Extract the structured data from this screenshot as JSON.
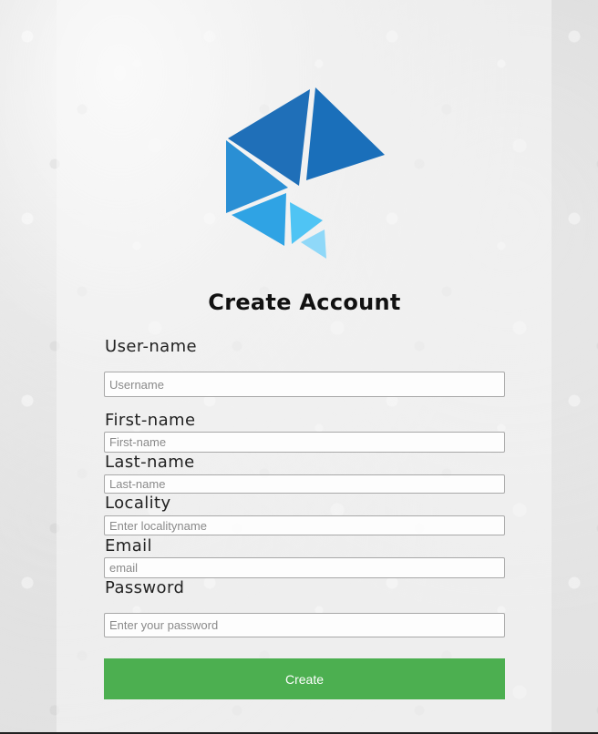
{
  "form": {
    "title": "Create Account",
    "fields": [
      {
        "label": "User-name",
        "placeholder": "Username",
        "value": ""
      },
      {
        "label": "First-name",
        "placeholder": "First-name",
        "value": ""
      },
      {
        "label": "Last-name",
        "placeholder": "Last-name",
        "value": ""
      },
      {
        "label": "Locality",
        "placeholder": "Enter localityname",
        "value": ""
      },
      {
        "label": "Email",
        "placeholder": "email",
        "value": ""
      },
      {
        "label": "Password",
        "placeholder": "Enter your password",
        "value": ""
      }
    ],
    "submit_label": "Create"
  },
  "logo": {
    "icon": "geometric-triangles-logo-icon",
    "colors": [
      "#1f6fb8",
      "#1a73c0",
      "#2a90d6",
      "#35a8e8",
      "#5cc8f5",
      "#8fdcfa"
    ]
  },
  "colors": {
    "button_bg": "#4caf50",
    "button_text": "#ffffff"
  }
}
